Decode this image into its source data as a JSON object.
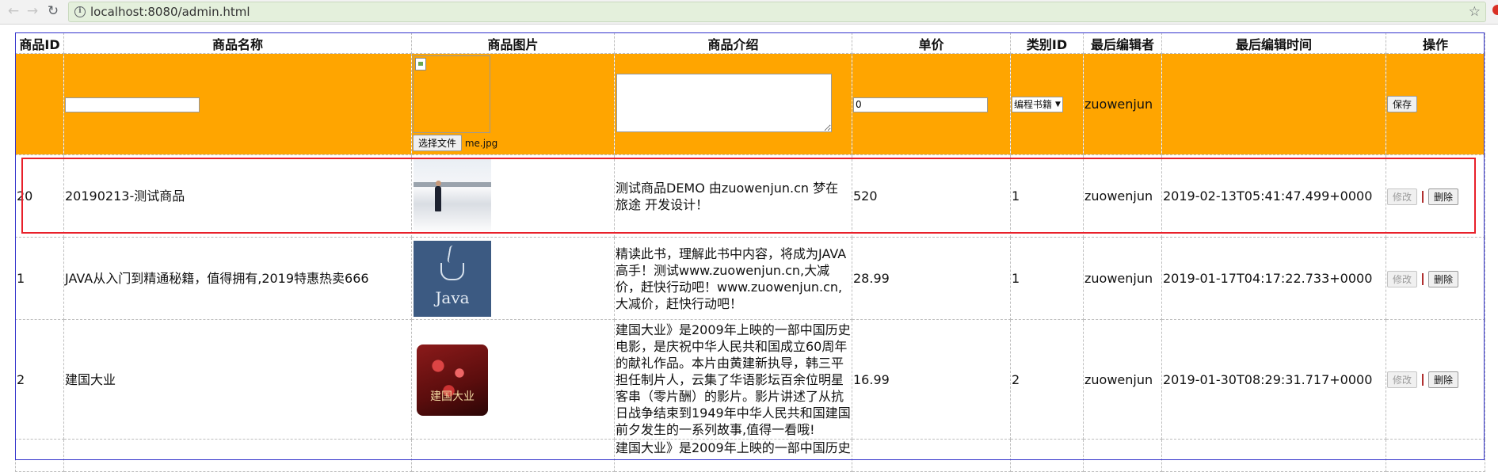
{
  "browser": {
    "url": "localhost:8080/admin.html"
  },
  "table": {
    "headers": [
      "商品ID",
      "商品名称",
      "商品图片",
      "商品介绍",
      "单价",
      "类别ID",
      "最后编辑者",
      "最后编辑时间",
      "操作"
    ],
    "edit_row": {
      "name_value": "",
      "image_alt": "",
      "file_button_label": "选择文件",
      "file_name": "me.jpg",
      "description_value": "",
      "price_value": "0",
      "category_selected": "编程书籍",
      "editor": "zuowenjun",
      "save_label": "保存"
    },
    "rows": [
      {
        "id": "20",
        "name": "20190213-测试商品",
        "description": "测试商品DEMO 由zuowenjun.cn 梦在旅途 开发设计！",
        "price": "520",
        "category_id": "1",
        "editor": "zuowenjun",
        "edit_time": "2019-02-13T05:41:47.499+0000",
        "edit_label": "修改",
        "delete_label": "删除"
      },
      {
        "id": "1",
        "name": "JAVA从入门到精通秘籍，值得拥有,2019特惠热卖666",
        "description": "精读此书，理解此书中内容，将成为JAVA高手！测试www.zuowenjun.cn,大减价，赶快行动吧！www.zuowenjun.cn,大减价，赶快行动吧！",
        "price": "28.99",
        "category_id": "1",
        "editor": "zuowenjun",
        "edit_time": "2019-01-17T04:17:22.733+0000",
        "edit_label": "修改",
        "delete_label": "删除",
        "image_text": "Java"
      },
      {
        "id": "2",
        "name": "建国大业",
        "description": "建国大业》是2009年上映的一部中国历史电影，是庆祝中华人民共和国成立60周年的献礼作品。本片由黄建新执导，韩三平担任制片人，云集了华语影坛百余位明星客串（零片酬）的影片。影片讲述了从抗日战争结束到1949年中华人民共和国建国前夕发生的一系列故事,值得一看哦!",
        "price": "16.99",
        "category_id": "2",
        "editor": "zuowenjun",
        "edit_time": "2019-01-30T08:29:31.717+0000",
        "edit_label": "修改",
        "delete_label": "删除",
        "image_text": "建国大业"
      }
    ],
    "partial_row": {
      "description": "建国大业》是2009年上映的一部中国历史"
    }
  },
  "colors": {
    "edit_row_bg": "#ffa500",
    "highlight_border": "#e8202a",
    "table_border": "#3333cc"
  }
}
